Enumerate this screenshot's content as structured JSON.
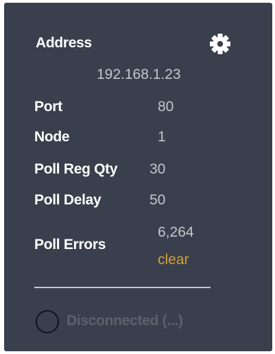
{
  "settings": {
    "address_label": "Address",
    "address_value": "192.168.1.23",
    "port_label": "Port",
    "port_value": "80",
    "node_label": "Node",
    "node_value": "1",
    "poll_reg_qty_label": "Poll Reg Qty",
    "poll_reg_qty_value": "30",
    "poll_delay_label": "Poll Delay",
    "poll_delay_value": "50",
    "poll_errors_label": "Poll Errors",
    "poll_errors_value": "6,264",
    "clear_label": "clear"
  },
  "icons": {
    "settings": "gear-icon",
    "status": "circle-outline-icon"
  },
  "status": {
    "text": "Disconnected (...)"
  },
  "colors": {
    "panel_bg": "#3a3f4d",
    "label": "#ffffff",
    "value": "#c3c6cc",
    "link": "#d7a030",
    "status_text": "#5d616b"
  }
}
